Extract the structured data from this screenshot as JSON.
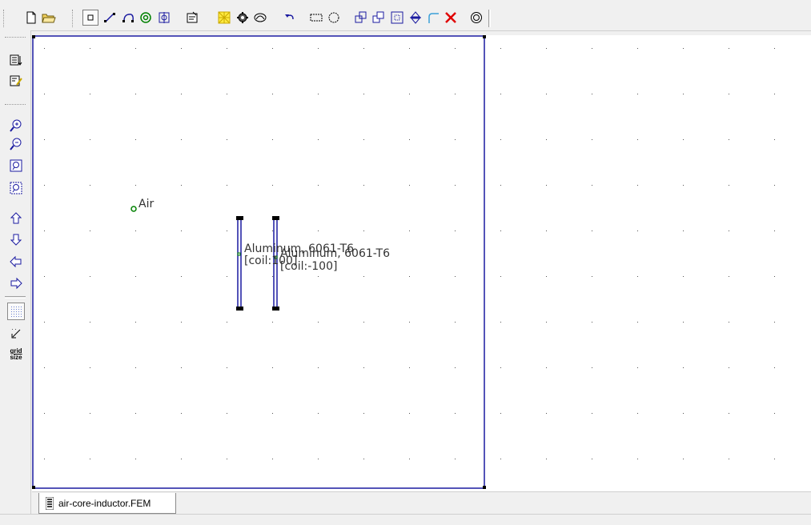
{
  "toolbar": {
    "buttons": [
      {
        "name": "new-document-icon",
        "tooltip": ""
      },
      {
        "name": "open-folder-icon",
        "tooltip": ""
      },
      {
        "name": "point-mode-icon",
        "tooltip": ""
      },
      {
        "name": "segment-mode-icon",
        "tooltip": ""
      },
      {
        "name": "arc-mode-icon",
        "tooltip": ""
      },
      {
        "name": "block-label-mode-icon",
        "tooltip": ""
      },
      {
        "name": "group-mode-icon",
        "tooltip": ""
      },
      {
        "name": "properties-icon",
        "tooltip": ""
      },
      {
        "name": "mesh-icon",
        "tooltip": ""
      },
      {
        "name": "run-analysis-icon",
        "tooltip": ""
      },
      {
        "name": "view-results-icon",
        "tooltip": ""
      },
      {
        "name": "undo-icon",
        "tooltip": ""
      },
      {
        "name": "select-rectangle-icon",
        "tooltip": ""
      },
      {
        "name": "select-circle-icon",
        "tooltip": ""
      },
      {
        "name": "move-icon",
        "tooltip": ""
      },
      {
        "name": "copy-icon",
        "tooltip": ""
      },
      {
        "name": "scale-icon",
        "tooltip": ""
      },
      {
        "name": "mirror-icon",
        "tooltip": ""
      },
      {
        "name": "fillet-icon",
        "tooltip": ""
      },
      {
        "name": "delete-icon",
        "tooltip": ""
      },
      {
        "name": "open-boundary-icon",
        "tooltip": ""
      }
    ]
  },
  "left_toolbar": {
    "grid_size_label_line1": "grid",
    "grid_size_label_line2": "size"
  },
  "canvas": {
    "labels": [
      {
        "id": "air",
        "text": "Air"
      },
      {
        "id": "coil1-material",
        "text": "Aluminum, 6061-T6"
      },
      {
        "id": "coil1-circuit",
        "text": "[coil:100]"
      },
      {
        "id": "coil2-material",
        "text": "Aluminum, 6061-T6"
      },
      {
        "id": "coil2-circuit",
        "text": "[coil:-100]"
      }
    ]
  },
  "tabs": [
    {
      "label": "air-core-inductor.FEM",
      "icon": "coil-document-icon"
    }
  ],
  "colors": {
    "geometry": "#1a1aa0",
    "node": "#000000",
    "block_label": "#008000",
    "delete": "#e00000",
    "grid": "#555555"
  }
}
